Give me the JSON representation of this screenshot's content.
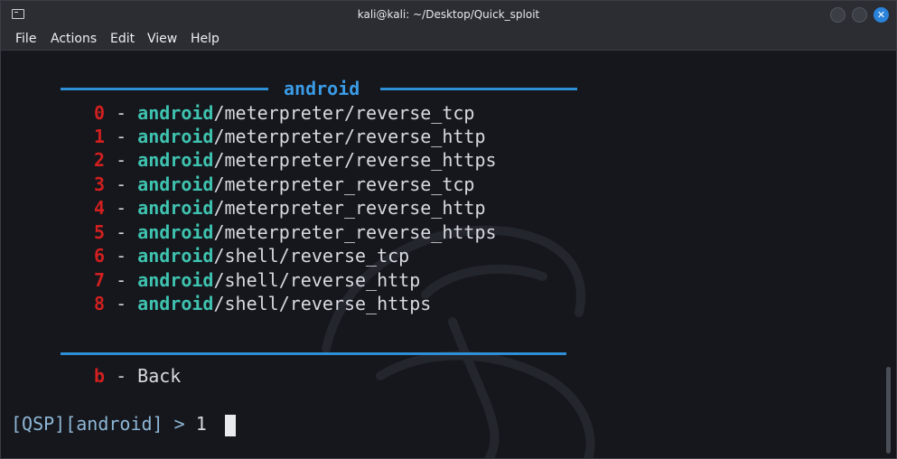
{
  "window": {
    "title": "kali@kali: ~/Desktop/Quick_sploit",
    "controls": [
      "minimize",
      "maximize",
      "close"
    ],
    "close_glyph": "✕"
  },
  "menu": [
    "File",
    "Actions",
    "Edit",
    "View",
    "Help"
  ],
  "terminal": {
    "header": "android",
    "options": [
      {
        "key": "0",
        "prefix": "android",
        "path": "/meterpreter/reverse_tcp"
      },
      {
        "key": "1",
        "prefix": "android",
        "path": "/meterpreter/reverse_http"
      },
      {
        "key": "2",
        "prefix": "android",
        "path": "/meterpreter/reverse_https"
      },
      {
        "key": "3",
        "prefix": "android",
        "path": "/meterpreter_reverse_tcp"
      },
      {
        "key": "4",
        "prefix": "android",
        "path": "/meterpreter_reverse_http"
      },
      {
        "key": "5",
        "prefix": "android",
        "path": "/meterpreter_reverse_https"
      },
      {
        "key": "6",
        "prefix": "android",
        "path": "/shell/reverse_tcp"
      },
      {
        "key": "7",
        "prefix": "android",
        "path": "/shell/reverse_http"
      },
      {
        "key": "8",
        "prefix": "android",
        "path": "/shell/reverse_https"
      }
    ],
    "separator": " - ",
    "back": {
      "key": "b",
      "label": "Back"
    },
    "prompt": "[QSP][android] > ",
    "input": "1"
  },
  "colors": {
    "header": "#3a9be6",
    "number": "#d21f1f",
    "keyword": "#3fc3b0",
    "text": "#d7dae0",
    "prompt": "#8fb7d6",
    "close_button": "#2a82da"
  }
}
